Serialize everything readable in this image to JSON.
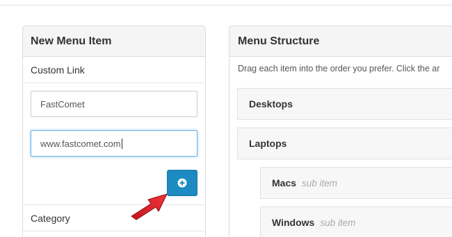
{
  "new_menu_item": {
    "title": "New Menu Item",
    "custom_link_label": "Custom Link",
    "link_name_value": "FastComet",
    "link_url_value": "www.fastcomet.com",
    "category_label": "Category"
  },
  "menu_structure": {
    "title": "Menu Structure",
    "instructions": "Drag each item into the order you prefer. Click the ar",
    "items": [
      {
        "name": "Desktops",
        "level": 0
      },
      {
        "name": "Laptops",
        "level": 0
      },
      {
        "name": "Macs",
        "level": 1,
        "sub_label": "sub item"
      },
      {
        "name": "Windows",
        "level": 1,
        "sub_label": "sub item"
      }
    ]
  },
  "colors": {
    "accent": "#1d8ac1",
    "arrow": "#e31e24",
    "focus": "#66afe9"
  },
  "icons": {
    "add": "plus-circle-icon",
    "pointer": "red-arrow-icon"
  }
}
